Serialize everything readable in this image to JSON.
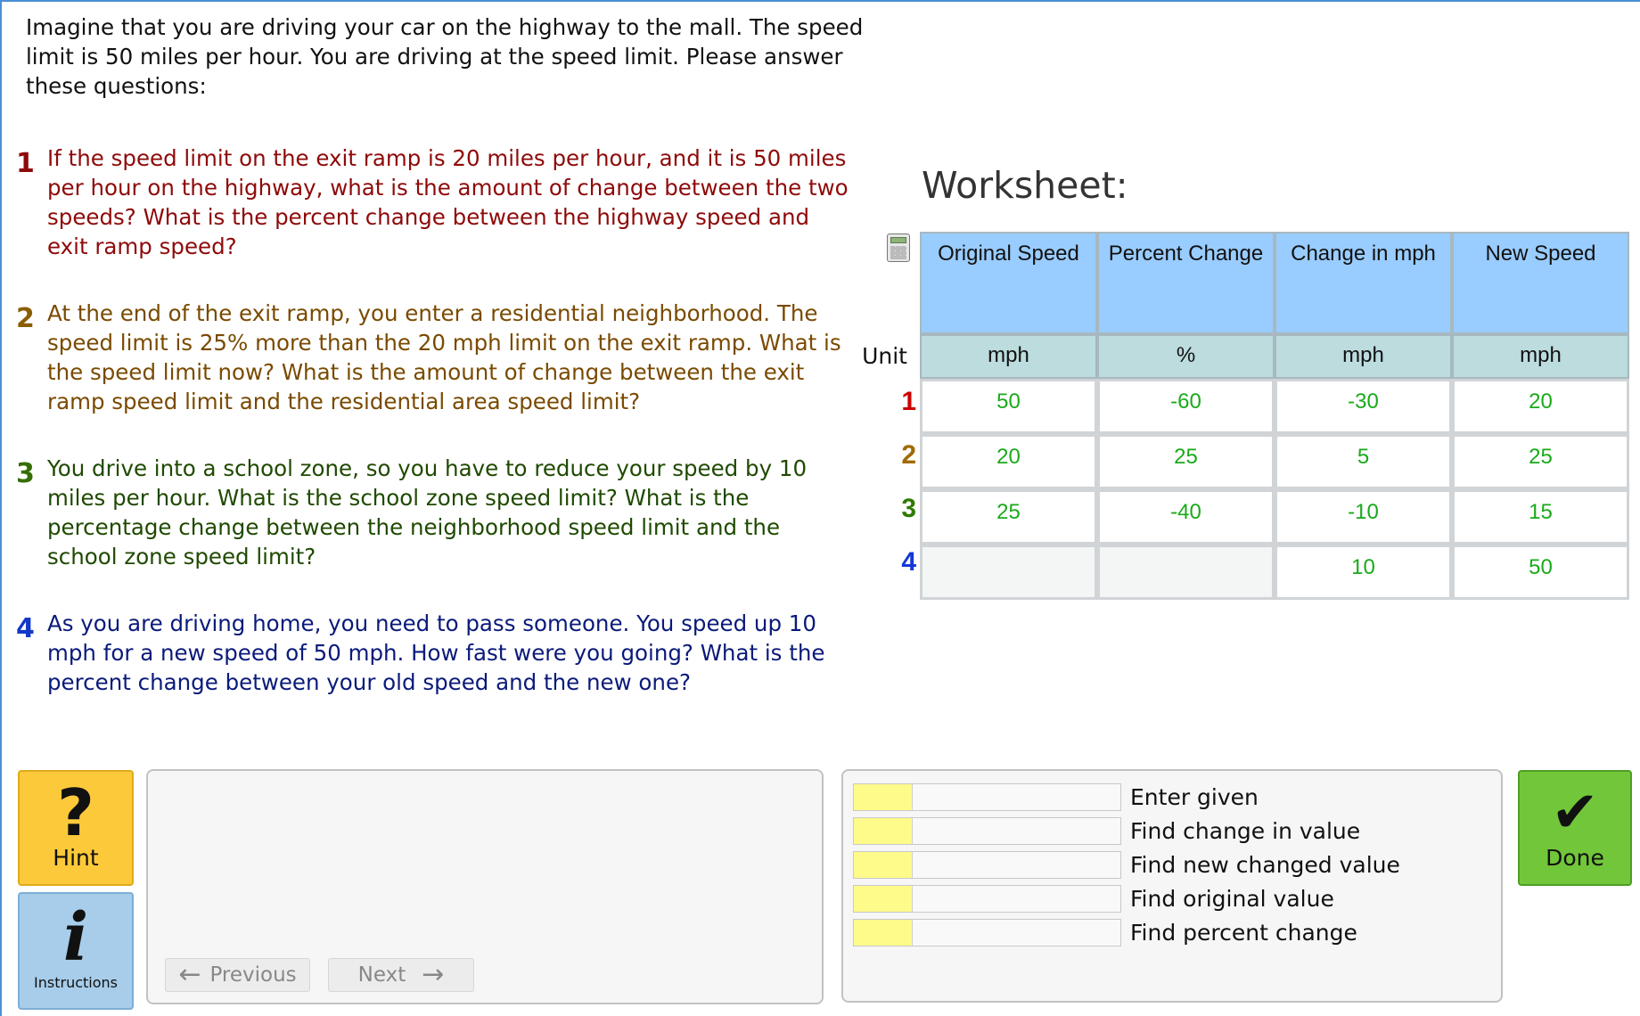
{
  "intro": "Imagine that you are driving your car on the highway to the mall. The speed limit is 50 miles per hour. You are driving at the speed limit. Please answer these questions:",
  "questions": [
    {
      "num": "1",
      "text": "If the speed limit on the exit ramp is 20 miles per hour, and it is 50 miles per hour on the highway, what is the amount of change between the two speeds? What is the percent change between the highway speed and exit ramp speed?"
    },
    {
      "num": "2",
      "text": "At the end of the exit ramp, you enter a residential neighborhood. The speed limit is 25% more than the 20 mph limit on the exit ramp. What is the speed limit now? What is the amount of change between the exit ramp speed limit and the residential area speed limit?"
    },
    {
      "num": "3",
      "text": "You drive into a school zone, so you have to reduce your speed by 10 miles per hour. What is the school zone speed limit? What is the percentage change between the neighborhood speed limit and the school zone speed limit?"
    },
    {
      "num": "4",
      "text": "As you are driving home, you need to pass someone. You speed up 10 mph for a new speed of 50 mph. How fast were you going? What is the percent change between your old speed and the new one?"
    }
  ],
  "worksheet": {
    "title": "Worksheet:",
    "unit_label": "Unit",
    "columns": [
      "Original Speed",
      "Percent Change",
      "Change in mph",
      "New Speed"
    ],
    "units": [
      "mph",
      "%",
      "mph",
      "mph"
    ],
    "rows": [
      {
        "label": "1",
        "color": "#cc0000",
        "cells": [
          "50",
          "-60",
          "-30",
          "20"
        ]
      },
      {
        "label": "2",
        "color": "#a06a00",
        "cells": [
          "20",
          "25",
          "5",
          "25"
        ]
      },
      {
        "label": "3",
        "color": "#2f7a00",
        "cells": [
          "25",
          "-40",
          "-10",
          "15"
        ]
      },
      {
        "label": "4",
        "color": "#1438d8",
        "cells": [
          "",
          "",
          "10",
          "50"
        ]
      }
    ],
    "value_color": "#1aaa1a",
    "icon": "calculator-icon"
  },
  "controls": {
    "hint_label": "Hint",
    "hint_glyph": "?",
    "instructions_label": "Instructions",
    "instructions_glyph": "i",
    "previous_label": "Previous",
    "next_label": "Next",
    "done_label": "Done",
    "done_glyph": "✔"
  },
  "skills": [
    {
      "label": "Enter given",
      "mastery": 0.22
    },
    {
      "label": "Find change in value",
      "mastery": 0.22
    },
    {
      "label": "Find new changed value",
      "mastery": 0.22
    },
    {
      "label": "Find original value",
      "mastery": 0.22
    },
    {
      "label": "Find percent change",
      "mastery": 0.22
    }
  ],
  "colors": {
    "hint": "#fcc93a",
    "instructions": "#a7cdea",
    "done": "#72c63a",
    "header": "#99ccff",
    "unit_row": "#bcdcde",
    "skill_fill": "#fffb8a"
  }
}
